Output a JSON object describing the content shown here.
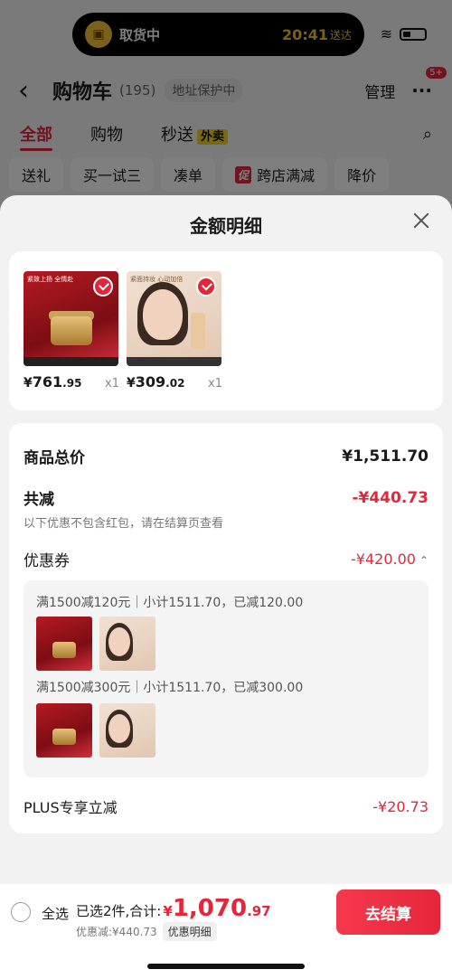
{
  "status": {
    "live_activity_title": "取货中",
    "time": "20:41",
    "time_suffix": "送达"
  },
  "nav": {
    "title": "购物车",
    "count": "(195)",
    "address": "地址保护中",
    "manage": "管理",
    "more_badge": "5+"
  },
  "tabs": [
    "全部",
    "购物",
    "秒送"
  ],
  "tab_badge": "外卖",
  "chips": [
    "送礼",
    "买一试三",
    "凑单",
    "跨店满减",
    "降价"
  ],
  "chip_promo_tag": "促",
  "sheet": {
    "title": "金额明细",
    "products": [
      {
        "yen": "¥",
        "int": "761",
        "dec": ".95",
        "qty": "x1"
      },
      {
        "yen": "¥",
        "int": "309",
        "dec": ".02",
        "qty": "x1"
      }
    ],
    "product_texts": [
      "紧致上扬 全情赴",
      "紧面持妆 心动加倍"
    ],
    "total_label": "商品总价",
    "total_value": "¥1,511.70",
    "reduce_label": "共减",
    "reduce_value": "-¥440.73",
    "reduce_note": "以下优惠不包含红包，请在结算页查看",
    "coupon_label": "优惠券",
    "coupon_value": "-¥420.00",
    "coupons": [
      "满1500减120元｜小计1511.70，已减120.00",
      "满1500减300元｜小计1511.70，已减300.00"
    ],
    "plus_label": "PLUS专享立减",
    "plus_value": "-¥20.73"
  },
  "bottom": {
    "select_all": "全选",
    "selected_text": "已选2件,合计:",
    "yen": "¥",
    "total_int": "1,070",
    "total_dec": ".97",
    "discount_text": "优惠减:¥440.73",
    "detail_pill": "优惠明细",
    "checkout": "去结算"
  },
  "colors": {
    "accent": "#e5263a",
    "highlight": "#f2d21f"
  }
}
